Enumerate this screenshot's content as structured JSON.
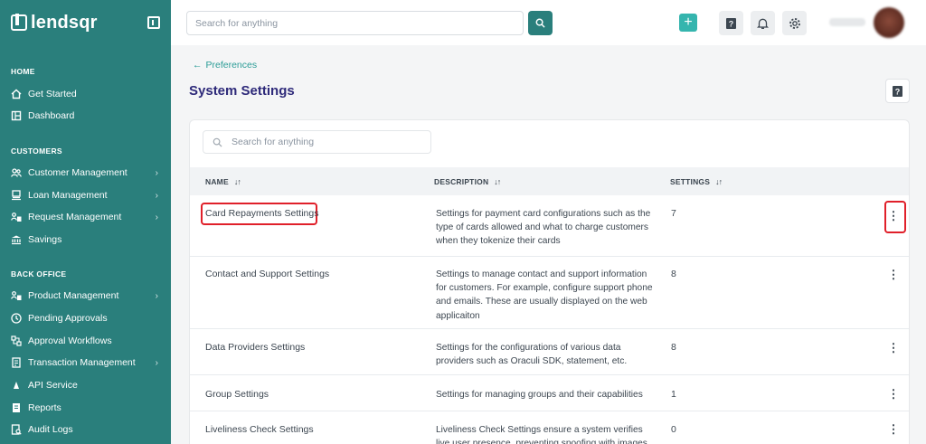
{
  "brand": {
    "name": "lendsqr"
  },
  "sidebar": {
    "sections": [
      {
        "title": "HOME",
        "items": [
          {
            "label": "Get Started",
            "icon": "home-icon",
            "chevron": false
          },
          {
            "label": "Dashboard",
            "icon": "dashboard-icon",
            "chevron": false
          }
        ]
      },
      {
        "title": "CUSTOMERS",
        "items": [
          {
            "label": "Customer Management",
            "icon": "users-icon",
            "chevron": true
          },
          {
            "label": "Loan Management",
            "icon": "loan-icon",
            "chevron": true
          },
          {
            "label": "Request Management",
            "icon": "request-icon",
            "chevron": true
          },
          {
            "label": "Savings",
            "icon": "savings-icon",
            "chevron": false
          }
        ]
      },
      {
        "title": "BACK OFFICE",
        "items": [
          {
            "label": "Product Management",
            "icon": "product-icon",
            "chevron": true
          },
          {
            "label": "Pending Approvals",
            "icon": "clock-icon",
            "chevron": false
          },
          {
            "label": "Approval Workflows",
            "icon": "workflow-icon",
            "chevron": false
          },
          {
            "label": "Transaction Management",
            "icon": "transaction-icon",
            "chevron": true
          },
          {
            "label": "API Service",
            "icon": "api-icon",
            "chevron": false
          },
          {
            "label": "Reports",
            "icon": "reports-icon",
            "chevron": false
          },
          {
            "label": "Audit Logs",
            "icon": "audit-icon",
            "chevron": false
          }
        ]
      }
    ]
  },
  "topbar": {
    "search_placeholder": "Search for anything"
  },
  "page": {
    "back_label": "Preferences",
    "title": "System Settings",
    "table_search_placeholder": "Search for anything",
    "columns": {
      "name": "NAME",
      "description": "DESCRIPTION",
      "settings": "SETTINGS"
    },
    "rows": [
      {
        "name": "Card Repayments Settings",
        "description": "Settings for payment card configurations such as the type of cards allowed and what to charge customers when they tokenize their cards",
        "count": "7"
      },
      {
        "name": "Contact and Support Settings",
        "description": "Settings to manage contact and support information for customers. For example, configure support phone and emails. These are usually displayed on the web applicaiton",
        "count": "8"
      },
      {
        "name": "Data Providers Settings",
        "description": "Settings for the configurations of various data providers such as Oraculi SDK, statement, etc.",
        "count": "8"
      },
      {
        "name": "Group Settings",
        "description": "Settings for managing groups and their capabilities",
        "count": "1"
      },
      {
        "name": "Liveliness Check Settings",
        "description": "Liveliness Check Settings ensure a system verifies live user presence, preventing spoofing with images",
        "count": "0"
      }
    ]
  },
  "colors": {
    "sidebar_bg": "#2a7f7c",
    "accent": "#35b5ae",
    "title": "#2e2a7a",
    "highlight": "#e0202a"
  }
}
